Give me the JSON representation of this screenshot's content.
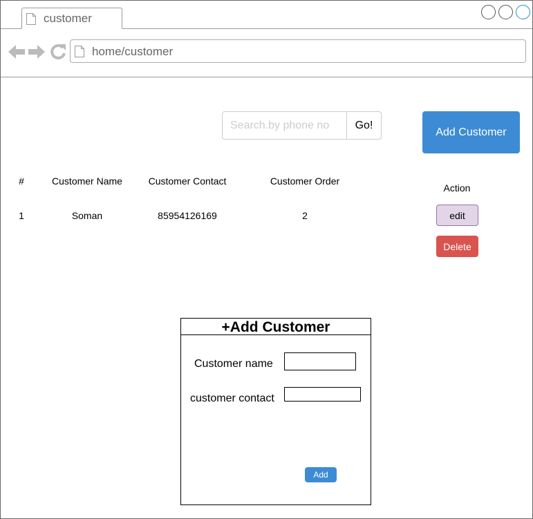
{
  "browser": {
    "tab_title": "customer",
    "url": "home/customer"
  },
  "toolbar": {
    "search_placeholder": "Search.by phone no",
    "go_label": "Go!",
    "add_customer_label": "Add Customer"
  },
  "table": {
    "headers": [
      "#",
      "Customer Name",
      "Customer Contact",
      "Customer Order",
      "Action"
    ],
    "rows": [
      {
        "index": "1",
        "name": "Soman",
        "contact": "85954126169",
        "order": "2"
      }
    ],
    "edit_label": "edit",
    "delete_label": "Delete"
  },
  "form": {
    "title": "+Add Customer",
    "name_label": "Customer name",
    "contact_label": "customer contact",
    "submit_label": "Add"
  },
  "colors": {
    "primary": "#3d8bd4",
    "danger": "#d9534f",
    "edit_fill": "#e1d5e7",
    "edit_border": "#9673a6"
  }
}
